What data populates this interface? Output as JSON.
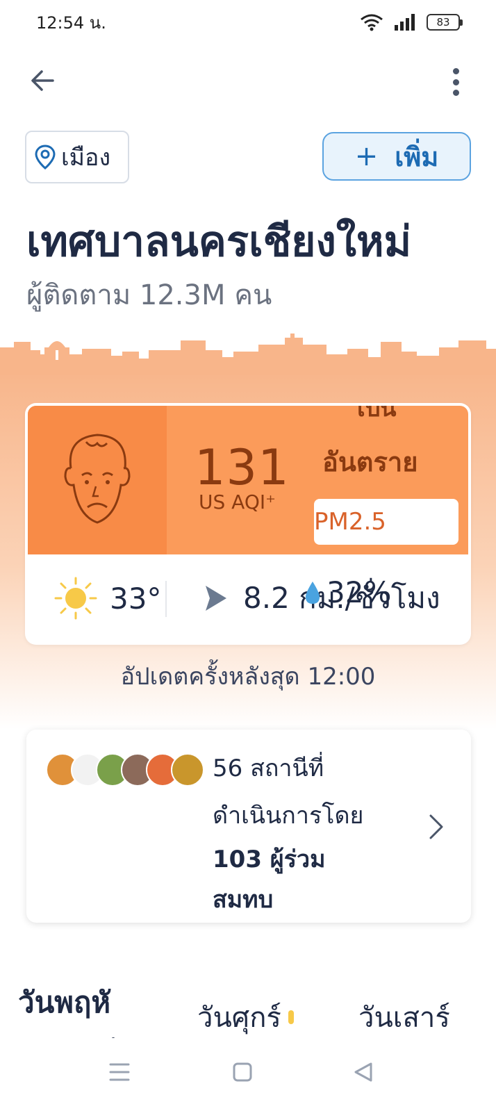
{
  "status_bar": {
    "time": "12:54 น.",
    "battery": "83"
  },
  "header": {
    "back_icon": "arrow-left-icon",
    "menu_icon": "more-vertical-icon"
  },
  "city_chip": {
    "label": "เมือง",
    "icon": "location-pin-icon"
  },
  "add_button": {
    "plus": "+",
    "label": "เพิ่ม"
  },
  "page": {
    "title": "เทศบาลนครเชียงใหม่",
    "followers": "ผู้ติดตาม 12.3M คน"
  },
  "aqi": {
    "value": "131",
    "unit": "US AQI⁺",
    "status_cut": "เป็น",
    "status": "อันตราย",
    "pollutant": "PM2.5",
    "face_icon": "unhappy-face-icon",
    "color": "#fb9b5a"
  },
  "weather": {
    "temperature": "33°",
    "wind": "8.2 กม./ชั่วโมง",
    "humidity": "32%",
    "icons": [
      "sun-icon",
      "wind-direction-icon",
      "humidity-drop-icon"
    ]
  },
  "updated": "อัปเดตครั้งหลังสุด 12:00",
  "stations": {
    "count_line": "56 สถานีที่",
    "operated_line": "ดำเนินการโดย",
    "contributors_line1": "103 ผู้ร่วม",
    "contributors_line2": "สมทบ"
  },
  "forecast": {
    "days": [
      "วันพฤหั",
      "วันศุกร์",
      "วันเสาร์"
    ],
    "active_sub": "สบดี"
  },
  "navbar": {
    "icons": [
      "menu-icon",
      "home-square-icon",
      "back-triangle-icon"
    ]
  }
}
